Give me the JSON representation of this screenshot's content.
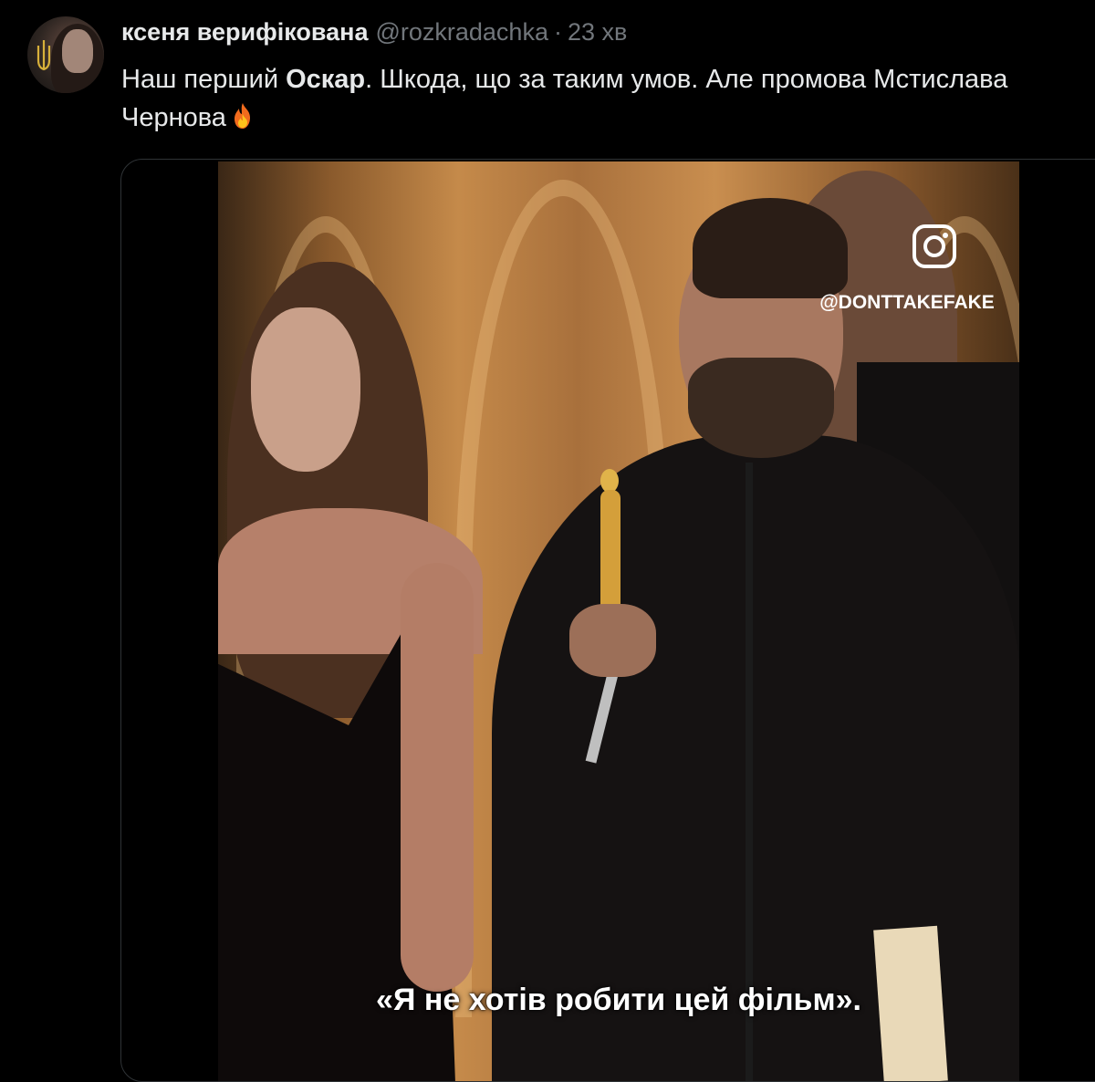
{
  "tweet": {
    "display_name": "ксеня верифікована",
    "handle": "@rozkradachka",
    "separator": "·",
    "timestamp": "23 хв",
    "text_before": "Наш перший ",
    "text_bold": "Оскар",
    "text_after": ". Шкода, що за таким умов. Але промова Мстислава Чернова",
    "emoji": "fire-icon"
  },
  "media": {
    "watermark": "@DONTTAKEFAKE",
    "watermark_icon": "instagram-icon",
    "subtitle": "«Я не хотів робити цей фільм»."
  },
  "colors": {
    "background": "#000000",
    "primary_text": "#e7e9ea",
    "secondary_text": "#71767b",
    "border": "#2f3336"
  }
}
